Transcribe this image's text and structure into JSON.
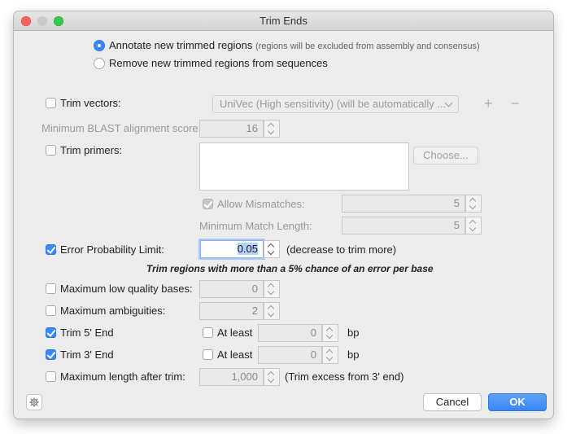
{
  "window": {
    "title": "Trim Ends"
  },
  "mode": {
    "annotate_label": "Annotate new trimmed regions",
    "annotate_note": "(regions will be excluded from assembly and consensus)",
    "remove_label": "Remove new trimmed regions from sequences"
  },
  "trim_vectors": {
    "label": "Trim vectors:",
    "database": "UniVec (High sensitivity) (will be automatically ...",
    "add": "+",
    "remove": "−"
  },
  "blast": {
    "label": "Minimum BLAST alignment score:",
    "value": "16"
  },
  "trim_primers": {
    "label": "Trim primers:",
    "choose": "Choose...",
    "allow_mismatches_label": "Allow Mismatches:",
    "allow_mismatches_value": "5",
    "min_match_label": "Minimum Match Length:",
    "min_match_value": "5"
  },
  "error_prob": {
    "label": "Error Probability Limit:",
    "value": "0.05",
    "hint": "(decrease to trim more)",
    "note": "Trim regions with more than a 5% chance of an error per base"
  },
  "low_quality": {
    "label": "Maximum low quality bases:",
    "value": "0"
  },
  "ambiguities": {
    "label": "Maximum ambiguities:",
    "value": "2"
  },
  "trim5": {
    "label": "Trim 5' End",
    "atleast": "At least",
    "value": "0",
    "unit": "bp"
  },
  "trim3": {
    "label": "Trim 3' End",
    "atleast": "At least",
    "value": "0",
    "unit": "bp"
  },
  "max_length": {
    "label": "Maximum length after trim:",
    "value": "1,000",
    "hint": "(Trim excess from 3' end)"
  },
  "buttons": {
    "cancel": "Cancel",
    "ok": "OK"
  },
  "colors": {
    "accent": "#3b88f5",
    "window_bg": "#ececec"
  }
}
